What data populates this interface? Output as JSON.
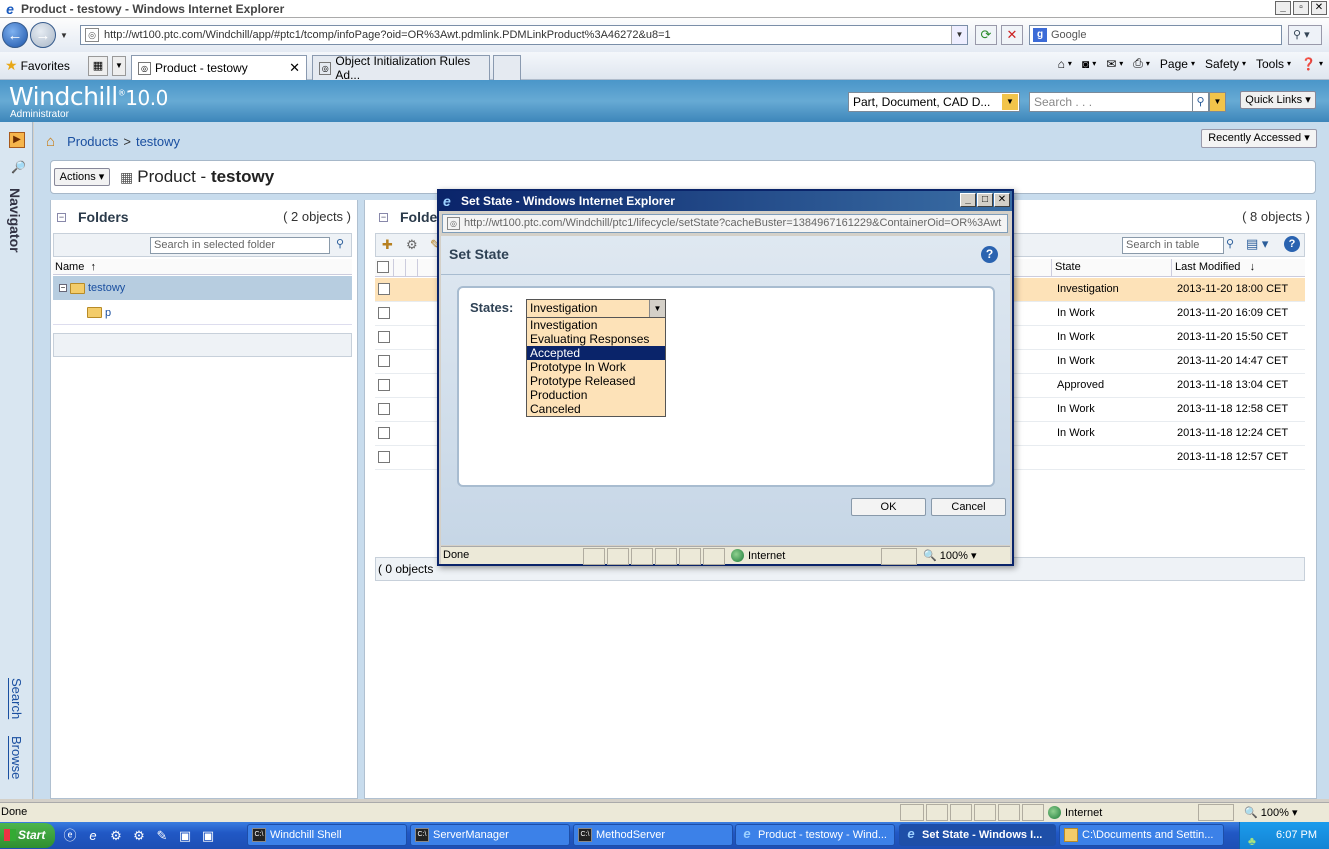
{
  "browser": {
    "window_title": "Product - testowy - Windows Internet Explorer",
    "url": "http://wt100.ptc.com/Windchill/app/#ptc1/tcomp/infoPage?oid=OR%3Awt.pdmlink.PDMLinkProduct%3A46272&u8=1",
    "search_provider": "Google",
    "favorites_label": "Favorites",
    "tabs": [
      {
        "label": "Product - testowy",
        "active": true
      },
      {
        "label": "Object Initialization Rules Ad...",
        "active": false
      }
    ],
    "commands": {
      "page": "Page",
      "safety": "Safety",
      "tools": "Tools"
    },
    "status_text": "Done",
    "zone": "Internet",
    "zoom": "100%"
  },
  "windchill": {
    "logo": "Windchill",
    "version": "10.0",
    "role": "Administrator",
    "type_filter": "Part, Document, CAD D...",
    "search_placeholder": "Search . . .",
    "quick_links": "Quick Links",
    "recently_accessed": "Recently Accessed",
    "navigator_label": "Navigator",
    "nav_search": "Search",
    "nav_browse": "Browse",
    "breadcrumb": {
      "root": "Products",
      "separator": ">",
      "current": "testowy"
    },
    "actions_label": "Actions",
    "title_prefix": "Product - ",
    "title_name": "testowy"
  },
  "folders_panel": {
    "title": "Folders",
    "count": "( 2 objects )",
    "search_placeholder": "Search in selected folder",
    "col_name": "Name",
    "sort_marker": "↑",
    "tree": [
      {
        "label": "testowy",
        "level": 0,
        "selected": true
      },
      {
        "label": "p",
        "level": 1,
        "selected": false
      }
    ]
  },
  "contents_panel": {
    "title": "Folde",
    "count": "( 8 objects )",
    "search_placeholder": "Search in table",
    "col_state": "State",
    "col_modified": "Last Modified",
    "sort_marker": "↓",
    "footer": "( 0 objects",
    "rows": [
      {
        "state": "Investigation",
        "modified": "2013-11-20 18:00 CET",
        "highlight": true
      },
      {
        "state": "In Work",
        "modified": "2013-11-20 16:09 CET"
      },
      {
        "state": "In Work",
        "modified": "2013-11-20 15:50 CET"
      },
      {
        "state": "In Work",
        "modified": "2013-11-20 14:47 CET"
      },
      {
        "state": "Approved",
        "modified": "2013-11-18 13:04 CET"
      },
      {
        "state": "In Work",
        "modified": "2013-11-18 12:58 CET"
      },
      {
        "state": "In Work",
        "modified": "2013-11-18 12:24 CET"
      },
      {
        "state": "",
        "modified": "2013-11-18 12:57 CET"
      }
    ]
  },
  "popup": {
    "window_title": "Set State - Windows Internet Explorer",
    "url": "http://wt100.ptc.com/Windchill/ptc1/lifecycle/setState?cacheBuster=1384967161229&ContainerOid=OR%3Awt",
    "heading": "Set State",
    "states_label": "States:",
    "selected_state": "Investigation",
    "options": [
      "Investigation",
      "Evaluating Responses",
      "Accepted",
      "Prototype In Work",
      "Prototype Released",
      "Production",
      "Canceled"
    ],
    "highlighted_option": "Accepted",
    "ok_label": "OK",
    "cancel_label": "Cancel",
    "status_text": "Done",
    "zone": "Internet",
    "zoom": "100%"
  },
  "taskbar": {
    "start_label": "Start",
    "buttons": [
      {
        "label": "Windchill Shell",
        "icon": "console-icon",
        "active": false
      },
      {
        "label": "ServerManager",
        "icon": "console-icon",
        "active": false
      },
      {
        "label": "MethodServer",
        "icon": "console-icon",
        "active": false
      },
      {
        "label": "Product - testowy - Wind...",
        "icon": "ie-icon",
        "active": false
      },
      {
        "label": "Set State - Windows I...",
        "icon": "ie-icon",
        "active": true
      },
      {
        "label": "C:\\Documents and Settin...",
        "icon": "folder-icon",
        "active": false
      }
    ],
    "clock": "6:07 PM"
  }
}
